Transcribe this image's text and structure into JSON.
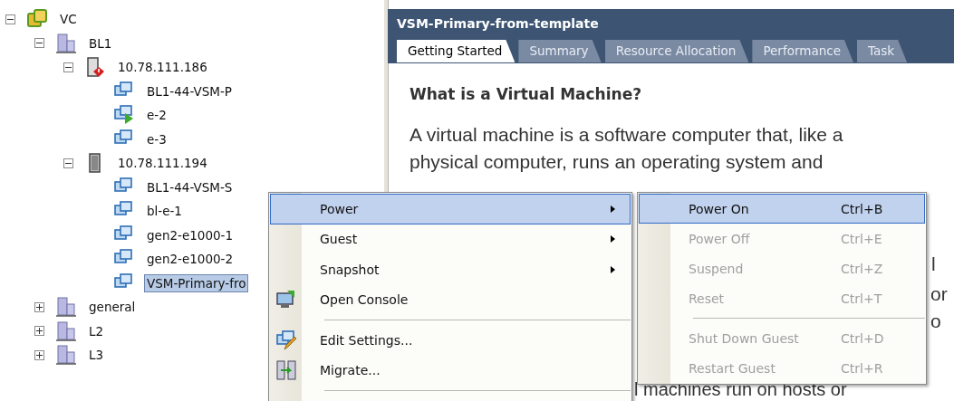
{
  "tree": [
    {
      "label": "VC",
      "kind": "vcenter",
      "expanded": true,
      "selected": false,
      "children": [
        {
          "label": "BL1",
          "kind": "datacenter",
          "expanded": true,
          "selected": false,
          "children": [
            {
              "label": "10.78.111.186",
              "kind": "host-alert",
              "expanded": true,
              "selected": false,
              "children": [
                {
                  "label": "BL1-44-VSM-P",
                  "kind": "vm",
                  "selected": false
                },
                {
                  "label": "e-2",
                  "kind": "vm-on",
                  "selected": false
                },
                {
                  "label": "e-3",
                  "kind": "vm",
                  "selected": false
                }
              ]
            },
            {
              "label": "10.78.111.194",
              "kind": "host",
              "expanded": true,
              "selected": false,
              "children": [
                {
                  "label": "BL1-44-VSM-S",
                  "kind": "vm",
                  "selected": false
                },
                {
                  "label": "bl-e-1",
                  "kind": "vm",
                  "selected": false
                },
                {
                  "label": "gen2-e1000-1",
                  "kind": "vm",
                  "selected": false
                },
                {
                  "label": "gen2-e1000-2",
                  "kind": "vm",
                  "selected": false
                },
                {
                  "label": "VSM-Primary-fro",
                  "kind": "vm",
                  "selected": true
                }
              ]
            }
          ]
        },
        {
          "label": "general",
          "kind": "datacenter",
          "expanded": false,
          "selected": false
        },
        {
          "label": "L2",
          "kind": "datacenter",
          "expanded": false,
          "selected": false
        },
        {
          "label": "L3",
          "kind": "datacenter",
          "expanded": false,
          "selected": false
        }
      ]
    }
  ],
  "panel": {
    "title": "VSM-Primary-from-template",
    "tabs": [
      {
        "label": "Getting Started",
        "selected": true
      },
      {
        "label": "Summary",
        "selected": false
      },
      {
        "label": "Resource Allocation",
        "selected": false
      },
      {
        "label": "Performance",
        "selected": false
      },
      {
        "label": "Task",
        "selected": false
      }
    ],
    "heading": "What is a Virtual Machine?",
    "paragraph_lines": [
      "A virtual machine is a software computer that, like a",
      "physical computer, runs an operating system and"
    ],
    "fragments": [
      "l",
      "or",
      "o"
    ],
    "lower_line": "l machines run on hosts or"
  },
  "context_menu": {
    "items": [
      {
        "kind": "submenu",
        "label": "Power",
        "selected": true
      },
      {
        "kind": "submenu",
        "label": "Guest",
        "selected": false
      },
      {
        "kind": "submenu",
        "label": "Snapshot",
        "selected": false
      },
      {
        "kind": "item",
        "label": "Open Console",
        "selected": false
      },
      {
        "kind": "separator"
      },
      {
        "kind": "item",
        "label": "Edit Settings...",
        "selected": false
      },
      {
        "kind": "item",
        "label": "Migrate...",
        "selected": false
      },
      {
        "kind": "separator"
      }
    ]
  },
  "submenu": {
    "items": [
      {
        "kind": "item",
        "label": "Power On",
        "shortcut": "Ctrl+B",
        "selected": true,
        "disabled": false
      },
      {
        "kind": "item",
        "label": "Power Off",
        "shortcut": "Ctrl+E",
        "selected": false,
        "disabled": true
      },
      {
        "kind": "item",
        "label": "Suspend",
        "shortcut": "Ctrl+Z",
        "selected": false,
        "disabled": true
      },
      {
        "kind": "item",
        "label": "Reset",
        "shortcut": "Ctrl+T",
        "selected": false,
        "disabled": true
      },
      {
        "kind": "separator"
      },
      {
        "kind": "item",
        "label": "Shut Down Guest",
        "shortcut": "Ctrl+D",
        "selected": false,
        "disabled": true
      },
      {
        "kind": "item",
        "label": "Restart Guest",
        "shortcut": "Ctrl+R",
        "selected": false,
        "disabled": true
      }
    ]
  }
}
